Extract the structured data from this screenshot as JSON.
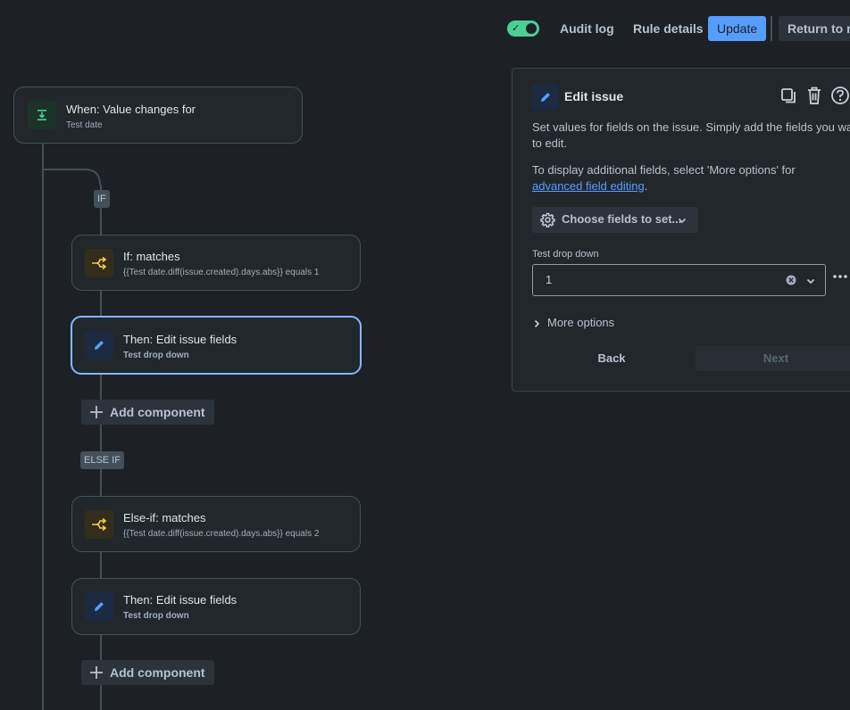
{
  "header": {
    "toggle_state": "on",
    "audit_log": "Audit log",
    "rule_details": "Rule details",
    "update": "Update",
    "return_to_rules": "Return to ru"
  },
  "flow": {
    "trigger": {
      "title": "When: Value changes for",
      "subtitle": "Test date"
    },
    "if_label": "IF",
    "if_condition": {
      "title": "If: matches",
      "subtitle": "{{Test date.diff(issue.created).days.abs}} equals 1"
    },
    "if_action": {
      "title": "Then: Edit issue fields",
      "subtitle": "Test drop down"
    },
    "add_component_1": "Add component",
    "else_if_label": "ELSE IF",
    "elseif_condition": {
      "title": "Else-if: matches",
      "subtitle": "{{Test date.diff(issue.created).days.abs}} equals 2"
    },
    "elseif_action": {
      "title": "Then: Edit issue fields",
      "subtitle": "Test drop down"
    },
    "add_component_2": "Add component"
  },
  "panel": {
    "title": "Edit issue",
    "description_line1": "Set values for fields on the issue. Simply add the fields you want",
    "description_line2": "to edit.",
    "more_info_prefix": "To display additional fields, select 'More options' for ",
    "more_info_link": "advanced field editing",
    "more_info_suffix": ".",
    "choose_fields": "Choose fields to set...",
    "field_label": "Test drop down",
    "field_value": "1",
    "more_options": "More options",
    "back": "Back",
    "next": "Next"
  },
  "colors": {
    "accent": "#579dff",
    "toggle_on": "#4bce97",
    "condition_icon": "#f5cd47",
    "trigger_icon": "#4bce97"
  }
}
